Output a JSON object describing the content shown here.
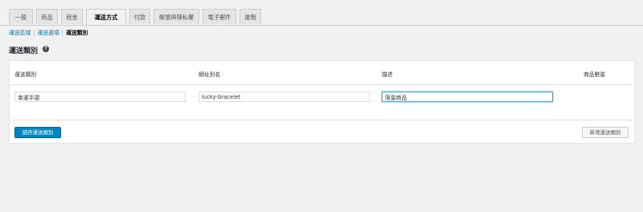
{
  "tabs": [
    "一般",
    "商品",
    "稅金",
    "運送方式",
    "付款",
    "帳號與隱私權",
    "電子郵件",
    "進階"
  ],
  "active_tab_index": 3,
  "subnav": {
    "zones": "運送區域",
    "options": "運送選項",
    "classes": "運送類別"
  },
  "heading": "運送類別",
  "help_icon": "question-circle-icon",
  "table": {
    "columns": [
      "運送類別",
      "網址別名",
      "描述",
      "商品數量"
    ],
    "row": {
      "name": "幸運手環",
      "slug": "lucky-bracelet",
      "description": "限量商品"
    }
  },
  "buttons": {
    "save": "儲存運送類別",
    "add": "新增運送類別"
  },
  "colors": {
    "primary": "#0085ba",
    "link": "#0073aa",
    "background": "#f1f1f1"
  }
}
